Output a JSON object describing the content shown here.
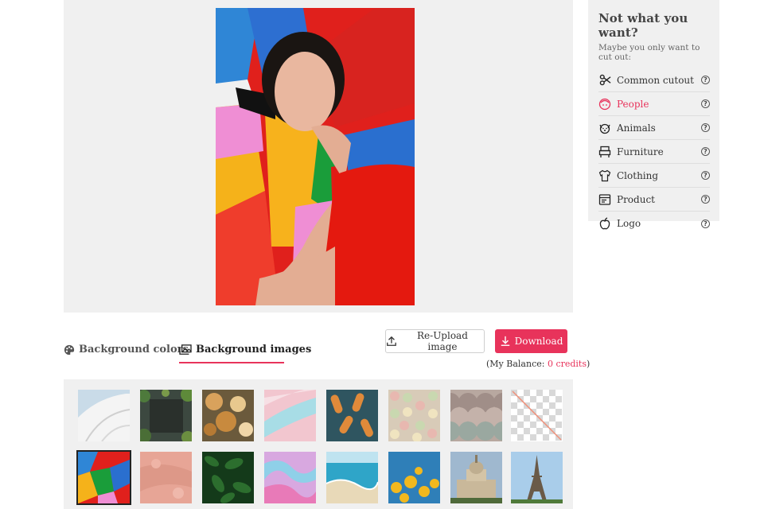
{
  "side_panel": {
    "title": "Not what you want?",
    "subtitle": "Maybe you only want to cut out:",
    "items": [
      {
        "label": "Common cutout",
        "icon": "scissors-icon"
      },
      {
        "label": "People",
        "icon": "face-icon"
      },
      {
        "label": "Animals",
        "icon": "dog-icon"
      },
      {
        "label": "Furniture",
        "icon": "furniture-icon"
      },
      {
        "label": "Clothing",
        "icon": "shirt-icon"
      },
      {
        "label": "Product",
        "icon": "product-icon"
      },
      {
        "label": "Logo",
        "icon": "apple-icon"
      }
    ],
    "active_item": "People",
    "help_glyph": "?"
  },
  "tabs": {
    "colors_label": "Background colors",
    "images_label": "Background images",
    "active": "Background images"
  },
  "buttons": {
    "reupload_label": "Re-Upload image",
    "download_label": "Download"
  },
  "balance": {
    "prefix": "(My Balance:",
    "credits": "0 credits",
    "suffix": ")"
  },
  "thumbnails": [
    {
      "name": "architecture-white",
      "selected": false
    },
    {
      "name": "dark-foliage",
      "selected": false
    },
    {
      "name": "food-flatlay",
      "selected": false
    },
    {
      "name": "pastel-paint",
      "selected": false
    },
    {
      "name": "hotdogs-pattern",
      "selected": false
    },
    {
      "name": "candy-eggs",
      "selected": false
    },
    {
      "name": "scale-tiles",
      "selected": false
    },
    {
      "name": "transparent",
      "selected": false
    },
    {
      "name": "color-blocks",
      "selected": true
    },
    {
      "name": "pink-texture",
      "selected": false
    },
    {
      "name": "green-leaves",
      "selected": false
    },
    {
      "name": "marble-swirl",
      "selected": false
    },
    {
      "name": "ocean-beach",
      "selected": false
    },
    {
      "name": "yellow-flowers",
      "selected": false
    },
    {
      "name": "palace-building",
      "selected": false
    },
    {
      "name": "eiffel-tower",
      "selected": false
    }
  ],
  "colors": {
    "accent": "#e8335b",
    "panel": "#f0f0f0"
  }
}
